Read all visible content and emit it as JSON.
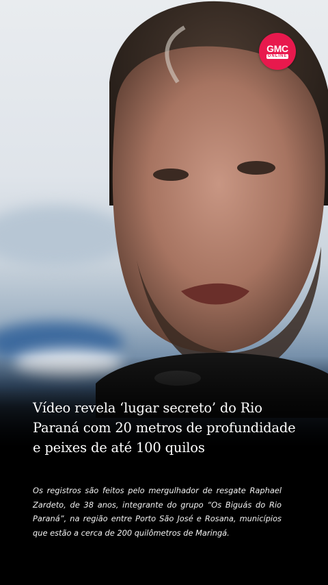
{
  "logo": {
    "main": "GMC",
    "sub": "ONLINE",
    "color": "#e8194d"
  },
  "headline": "Vídeo revela ‘lugar secreto’ do Rio Paraná com 20 metros de profundidade e peixes de até 100 quilos",
  "body": "Os registros são feitos pelo mergulhador de resgate Raphael Zardeto, de 38 anos, integrante do grupo “Os Biguás do Rio Paraná”, na região entre Porto São José e Rosana, municípios que estão a cerca de 200 quilômetros de Maringá.",
  "colors": {
    "background": "#000000",
    "text": "#ffffff"
  }
}
